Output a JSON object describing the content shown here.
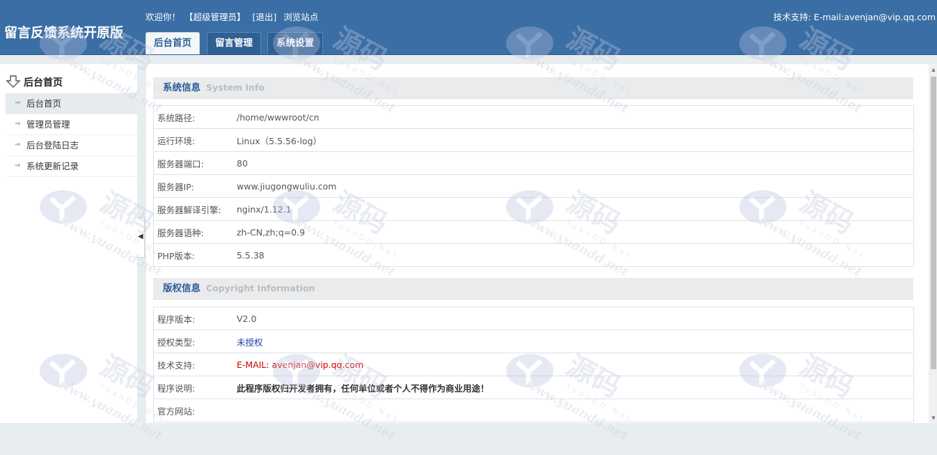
{
  "header": {
    "logo": "留言反馈系统开原版",
    "welcome": "欢迎你！",
    "role": "【超级管理员】",
    "logout": "[退出]",
    "browse": "浏览站点",
    "support": "技术支持: E-mail:avenjan@vip.qq.com",
    "tabs": [
      {
        "label": "后台首页",
        "active": true
      },
      {
        "label": "留言管理",
        "active": false
      },
      {
        "label": "系统设置",
        "active": false
      }
    ]
  },
  "sidebar": {
    "title": "后台首页",
    "items": [
      {
        "label": "后台首页",
        "active": true
      },
      {
        "label": "管理员管理",
        "active": false
      },
      {
        "label": "后台登陆日志",
        "active": false
      },
      {
        "label": "系统更新记录",
        "active": false
      }
    ]
  },
  "system_info": {
    "title": "系统信息",
    "subtitle": "System  Info",
    "rows": [
      {
        "key": "系统路径:",
        "value": "/home/wwwroot/cn"
      },
      {
        "key": "运行环境:",
        "value": "Linux（5.5.56-log）"
      },
      {
        "key": "服务器端口:",
        "value": "80"
      },
      {
        "key": "服务器IP:",
        "value": "www.jiugongwuliu.com"
      },
      {
        "key": "服务器解译引擎:",
        "value": "nginx/1.12.1"
      },
      {
        "key": "服务器语种:",
        "value": "zh-CN,zh;q=0.9"
      },
      {
        "key": "PHP版本:",
        "value": "5.5.38"
      }
    ]
  },
  "copyright_info": {
    "title": "版权信息",
    "subtitle": "Copyright Information",
    "rows": [
      {
        "key": "程序版本:",
        "value": "V2.0",
        "style": ""
      },
      {
        "key": "授权类型:",
        "value": "未授权",
        "style": "blue"
      },
      {
        "key": "技术支持:",
        "value": "E-MAIL: avenjan@vip.qq.com",
        "style": "red"
      },
      {
        "key": "程序说明:",
        "value": "此程序版权归开发者拥有，任何单位或者个人不得作为商业用途！",
        "style": "bold"
      },
      {
        "key": "官方网站:",
        "value": "",
        "style": ""
      }
    ]
  },
  "watermark": {
    "brand": "源码",
    "sub": "YuanDD.Net",
    "url": "www.yuandd.net"
  },
  "colors": {
    "header_bg": "#3a6ea5",
    "section_title": "#2c5c99",
    "link_blue": "#1f3fa6",
    "alert_red": "#d10000"
  }
}
